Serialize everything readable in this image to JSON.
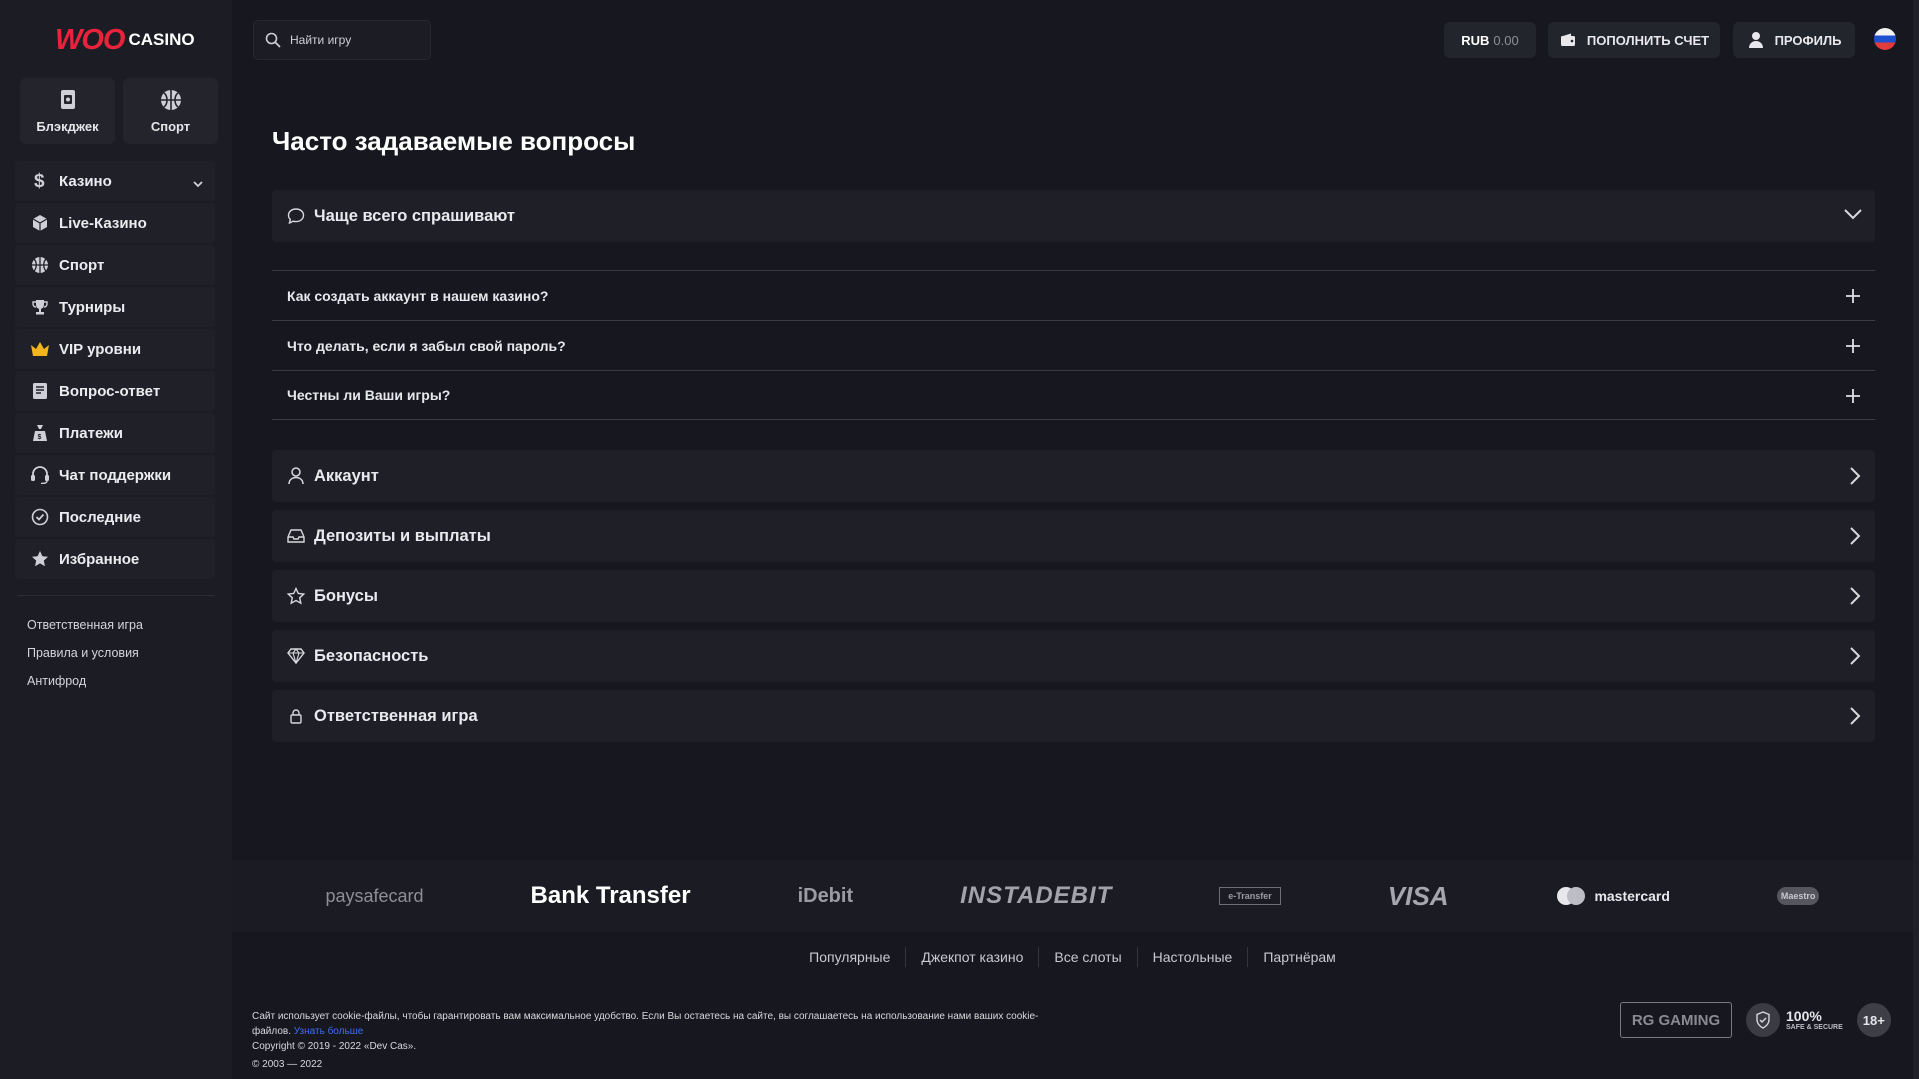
{
  "brand": {
    "logo_woo": "WOO",
    "logo_casino": "CASINO"
  },
  "quick_links": [
    {
      "label": "Блэкджек",
      "icon": "blackjack-card-icon"
    },
    {
      "label": "Спорт",
      "icon": "basketball-icon"
    }
  ],
  "sidebar": {
    "items": [
      {
        "label": "Казино",
        "icon": "dollar-icon"
      },
      {
        "label": "Live-Казино",
        "icon": "cube-icon"
      },
      {
        "label": "Спорт",
        "icon": "ball-icon"
      },
      {
        "label": "Турниры",
        "icon": "trophy-icon"
      },
      {
        "label": "VIP уровни",
        "icon": "crown-icon"
      },
      {
        "label": "Вопрос-ответ",
        "icon": "document-icon"
      },
      {
        "label": "Платежи",
        "icon": "money-bag-icon"
      },
      {
        "label": "Чат поддержки",
        "icon": "headset-icon"
      },
      {
        "label": "Последние",
        "icon": "clock-check-icon"
      },
      {
        "label": "Избранное",
        "icon": "star-icon"
      }
    ],
    "links": [
      "Ответственная игра",
      "Правила и условия",
      "Антифрод"
    ]
  },
  "header": {
    "search_placeholder": "Найти игру",
    "balance_currency": "RUB",
    "balance_amount": "0.00",
    "deposit_label": "ПОПОЛНИТЬ СЧЕТ",
    "profile_label": "ПРОФИЛЬ"
  },
  "main": {
    "title": "Часто задаваемые вопросы",
    "faq_section_title": "Чаще всего спрашивают",
    "questions": [
      "Как создать аккаунт в нашем казино?",
      "Что делать, если я забыл свой пароль?",
      "Честны ли Ваши игры?"
    ],
    "categories": [
      {
        "label": "Аккаунт",
        "icon": "user-icon"
      },
      {
        "label": "Депозиты и выплаты",
        "icon": "inbox-icon"
      },
      {
        "label": "Бонусы",
        "icon": "star-outline-icon"
      },
      {
        "label": "Безопасность",
        "icon": "diamond-icon"
      },
      {
        "label": "Ответственная игра",
        "icon": "lock-icon"
      }
    ]
  },
  "footer": {
    "payments": [
      "paysafecard",
      "Bank Transfer",
      "iDebit",
      "INSTADEBIT",
      "e-Transfer",
      "VISA",
      "mastercard",
      "Maestro"
    ],
    "nav": [
      "Популярные",
      "Джекпот казино",
      "Все слоты",
      "Настольные",
      "Партнёрам"
    ],
    "cookie_text": "Сайт использует cookie-файлы, чтобы гарантировать вам максимальное удобство. Если Вы остаетесь на сайте, вы соглашаетесь на использование нами ваших cookie-файлов.",
    "cookie_link": "Узнать больше",
    "copyright": "Copyright © 2019 - 2022 «Dev Cas».",
    "years": "© 2003 — 2022",
    "rg_badge": "RG GAMING",
    "secure_big": "100%",
    "secure_small": "SAFE & SECURE",
    "age": "18+"
  },
  "colors": {
    "background": "#17181f",
    "sidebar": "#1c1d24",
    "accent_red": "#e8233b",
    "link_blue": "#3d6ff2"
  }
}
